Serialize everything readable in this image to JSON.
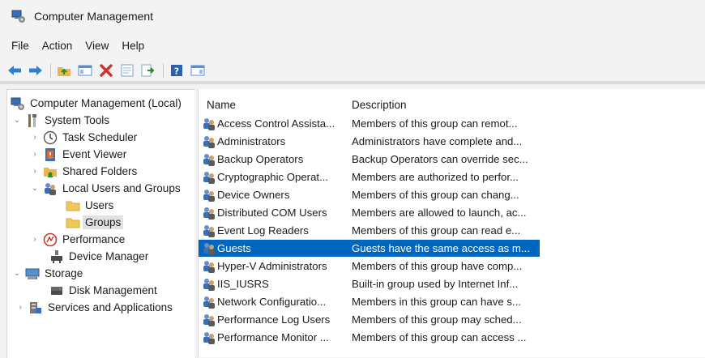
{
  "window": {
    "title": "Computer Management"
  },
  "menu": [
    "File",
    "Action",
    "View",
    "Help"
  ],
  "toolbar": {
    "buttons": [
      "back-icon",
      "forward-icon",
      "up-folder-icon",
      "show-hide-tree-icon",
      "delete-icon",
      "properties-icon",
      "export-list-icon",
      "help-icon",
      "show-hide-action-pane-icon"
    ]
  },
  "tree": {
    "root": "Computer Management (Local)",
    "system_tools": "System Tools",
    "task_scheduler": "Task Scheduler",
    "event_viewer": "Event Viewer",
    "shared_folders": "Shared Folders",
    "local_users_groups": "Local Users and Groups",
    "users": "Users",
    "groups": "Groups",
    "performance": "Performance",
    "device_manager": "Device Manager",
    "storage": "Storage",
    "disk_management": "Disk Management",
    "services_apps": "Services and Applications",
    "selected": "Groups"
  },
  "list": {
    "columns": [
      "Name",
      "Description"
    ],
    "rows": [
      {
        "name": "Access Control Assista...",
        "description": "Members of this group can remot..."
      },
      {
        "name": "Administrators",
        "description": "Administrators have complete and..."
      },
      {
        "name": "Backup Operators",
        "description": "Backup Operators can override sec..."
      },
      {
        "name": "Cryptographic Operat...",
        "description": "Members are authorized to perfor..."
      },
      {
        "name": "Device Owners",
        "description": "Members of this group can chang..."
      },
      {
        "name": "Distributed COM Users",
        "description": "Members are allowed to launch, ac..."
      },
      {
        "name": "Event Log Readers",
        "description": "Members of this group can read e..."
      },
      {
        "name": "Guests",
        "description": "Guests have the same access as m..."
      },
      {
        "name": "Hyper-V Administrators",
        "description": "Members of this group have comp..."
      },
      {
        "name": "IIS_IUSRS",
        "description": "Built-in group used by Internet Inf..."
      },
      {
        "name": "Network Configuratio...",
        "description": "Members in this group can have s..."
      },
      {
        "name": "Performance Log Users",
        "description": "Members of this group may sched..."
      },
      {
        "name": "Performance Monitor ...",
        "description": "Members of this group can access ..."
      }
    ],
    "selected": "Guests"
  },
  "colors": {
    "selection": "#0067c0",
    "tree_selection": "#e1e1e1",
    "delete": "#d32f2f",
    "help": "#2b5fb0"
  }
}
